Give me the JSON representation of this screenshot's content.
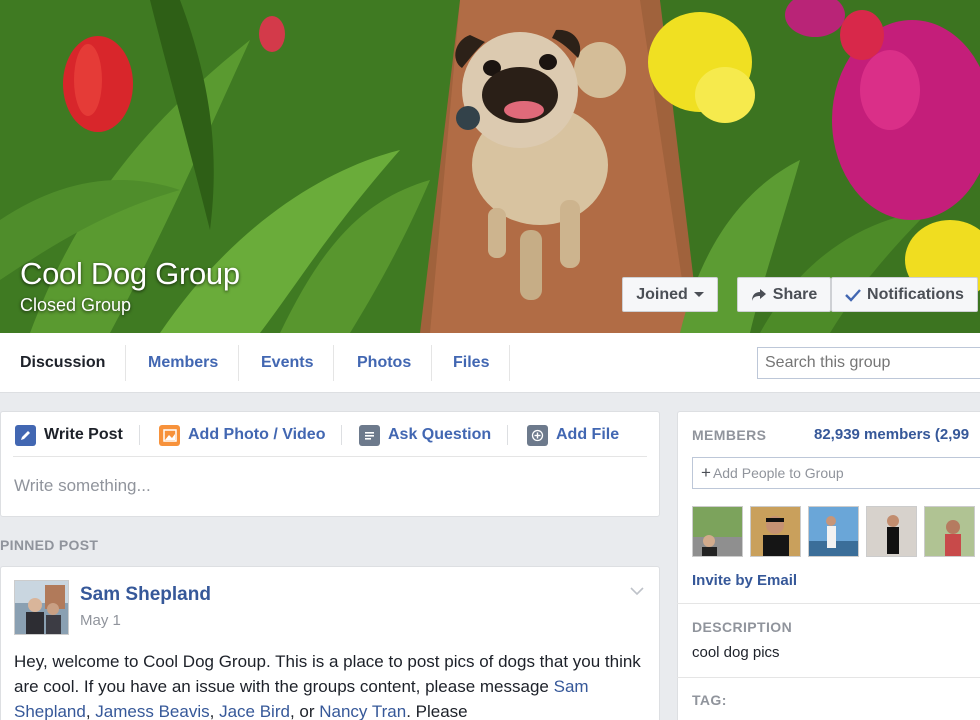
{
  "cover": {
    "group_name": "Cool Dog Group",
    "privacy": "Closed Group",
    "joined_label": "Joined",
    "share_label": "Share",
    "notifications_label": "Notifications"
  },
  "tabs": {
    "items": [
      "Discussion",
      "Members",
      "Events",
      "Photos",
      "Files"
    ],
    "active": "Discussion"
  },
  "search": {
    "placeholder": "Search this group"
  },
  "composer": {
    "write_post": "Write Post",
    "add_photo": "Add Photo / Video",
    "ask_question": "Ask Question",
    "add_file": "Add File",
    "placeholder": "Write something..."
  },
  "pinned": {
    "label": "PINNED POST",
    "author": "Sam Shepland",
    "date": "May 1",
    "text_1": "Hey, welcome to Cool Dog Group. This is a place to post pics of dogs that you think are cool. If you have an issue with the groups content, please message ",
    "mention_1": "Sam Shepland",
    "sep_1": ", ",
    "mention_2": "Jamess Beavis",
    "sep_2": ", ",
    "mention_3": "Jace Bird",
    "sep_3": ", or ",
    "mention_4": "Nancy Tran",
    "text_2": ". Please"
  },
  "sidebar": {
    "members_label": "MEMBERS",
    "members_count": "82,939 members (2,99",
    "add_people": "Add People to Group",
    "invite": "Invite by Email",
    "description_label": "DESCRIPTION",
    "description": "cool dog pics",
    "tag_label": "TAG:"
  },
  "colors": {
    "link": "#365899",
    "tab_link": "#4267b2",
    "background": "#e9ebee",
    "muted": "#90949c"
  },
  "icons": [
    "caret-down-icon",
    "share-arrow-icon",
    "checkmark-icon",
    "pencil-icon",
    "photo-icon",
    "question-icon",
    "file-plus-icon",
    "chevron-down-icon"
  ]
}
